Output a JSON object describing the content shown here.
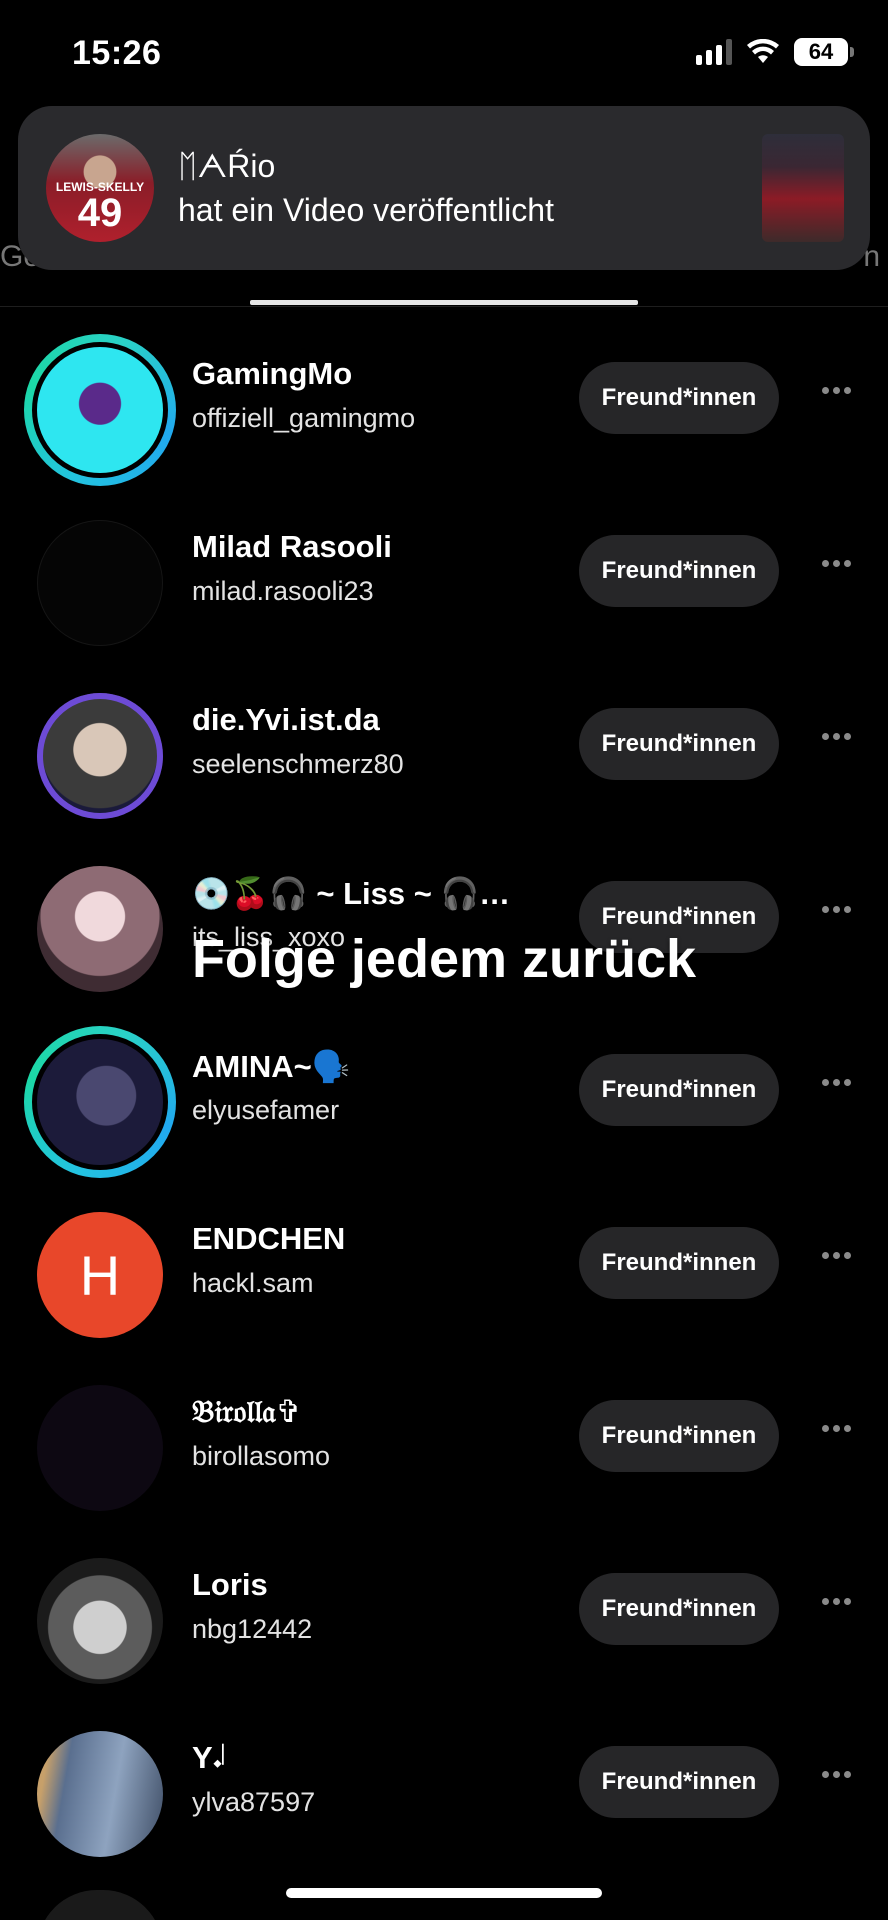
{
  "status_bar": {
    "time": "15:26",
    "battery": "64"
  },
  "notification": {
    "title": "ᛖᗅŔio",
    "body": "hat ein Video veröffentlicht",
    "avatar_jersey_name": "LEWIS-SKELLY",
    "avatar_jersey_number": "49"
  },
  "tabs": {
    "left_peek": "Ge",
    "right_peek": "n"
  },
  "list_items": [
    {
      "name": "GamingMo",
      "handle": "offiziell_gamingmo",
      "button": "Freund*innen"
    },
    {
      "name": "Milad Rasooli",
      "handle": "milad.rasooli23",
      "button": "Freund*innen"
    },
    {
      "name": "die.Yvi.ist.da",
      "handle": "seelenschmerz80",
      "button": "Freund*innen"
    },
    {
      "name": "💿🍒🎧 ~ Liss ~ 🎧…",
      "handle": "its_liss_xoxo",
      "button": "Freund*innen"
    },
    {
      "name": "AMINA~🗣️",
      "handle": "elyusefamer",
      "button": "Freund*innen"
    },
    {
      "name": "ENDCHEN",
      "handle": "hackl.sam",
      "button": "Freund*innen",
      "avatar_letter": "H"
    },
    {
      "name": "𝔅𝔦𝔯𝔬𝔩𝔩𝔞✞",
      "handle": "birollasomo",
      "button": "Freund*innen"
    },
    {
      "name": "Loris",
      "handle": "nbg12442",
      "button": "Freund*innen"
    },
    {
      "name": "Y𝆺𝅥",
      "handle": "ylva87597",
      "button": "Freund*innen"
    }
  ],
  "overlay_caption": "Folge jedem zurück",
  "colors": {
    "ring_start": "#23c3e0",
    "ring_end": "#1cd8a6",
    "endchen_avatar": "#e8472a",
    "button_bg": "#262628"
  }
}
